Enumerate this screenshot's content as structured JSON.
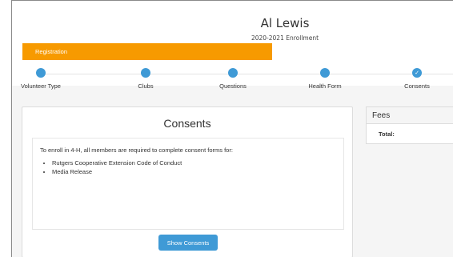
{
  "header": {
    "member_name": "Al Lewis",
    "enrollment_year": "2020-2021 Enrollment"
  },
  "progress": {
    "label": "Registration",
    "accent_color": "#f79a00"
  },
  "steps": [
    {
      "label": "Volunteer Type",
      "icon": "circle-icon",
      "completed": false
    },
    {
      "label": "Clubs",
      "icon": "circle-icon",
      "completed": false
    },
    {
      "label": "Questions",
      "icon": "circle-icon",
      "completed": false
    },
    {
      "label": "Health Form",
      "icon": "circle-icon",
      "completed": false
    },
    {
      "label": "Consents",
      "icon": "check-icon",
      "completed": true
    }
  ],
  "consents": {
    "title": "Consents",
    "intro": "To enroll in 4-H, all members are required to complete consent forms for:",
    "items": [
      "Rutgers Cooperative Extension Code of Conduct",
      "Media Release"
    ],
    "button_label": "Show Consents"
  },
  "fees": {
    "title": "Fees",
    "total_label": "Total:"
  },
  "colors": {
    "step_blue": "#3f9ad6",
    "button_blue": "#3f9ad6"
  }
}
